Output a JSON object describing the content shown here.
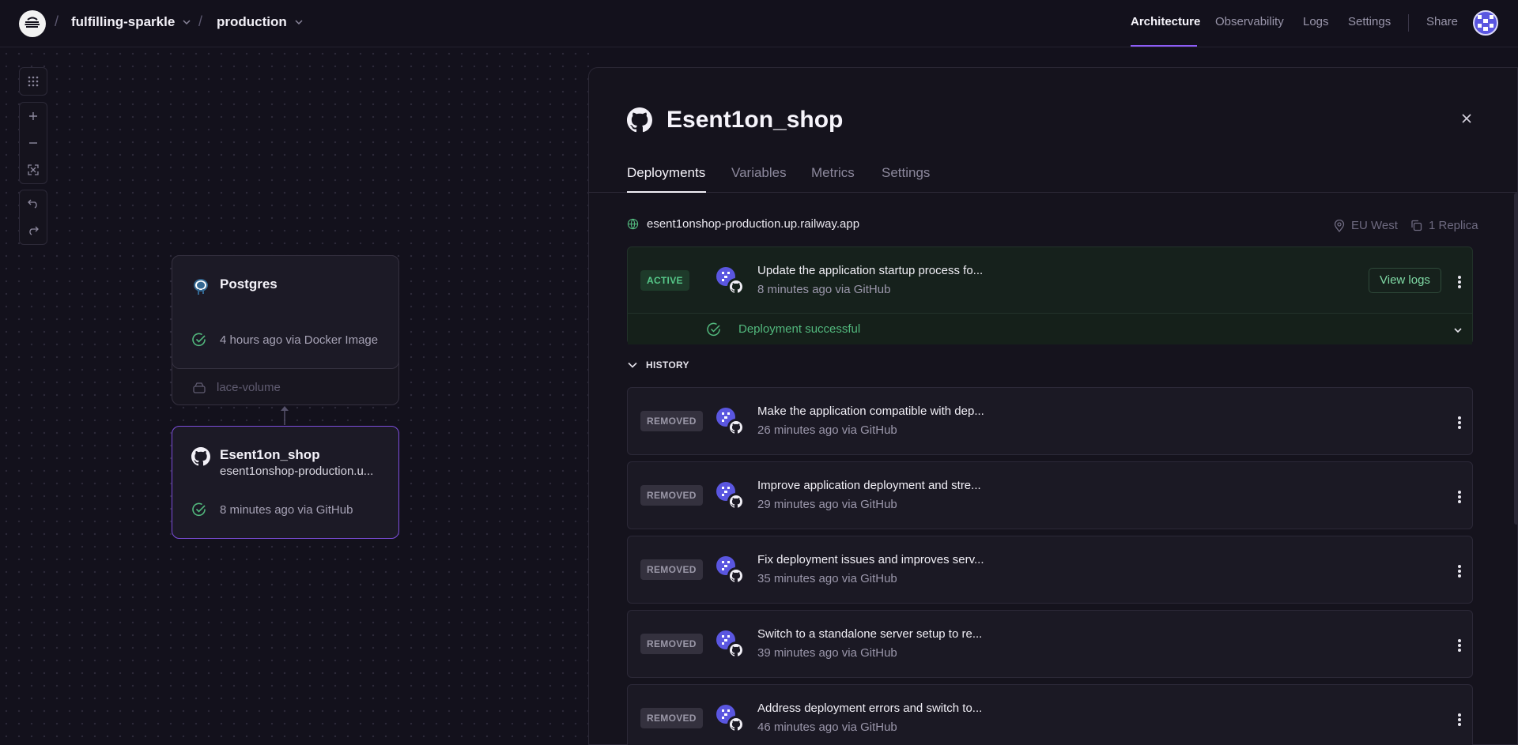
{
  "topbar": {
    "project": "fulfilling-sparkle",
    "environment": "production",
    "nav": [
      "Architecture",
      "Observability",
      "Logs",
      "Settings"
    ],
    "share": "Share"
  },
  "canvas": {
    "tools": [
      "grid-icon",
      "zoom-in-icon",
      "zoom-out-icon",
      "fit-icon",
      "undo-icon",
      "redo-icon"
    ],
    "postgres": {
      "name": "Postgres",
      "status": "4 hours ago via Docker Image",
      "volume": "lace-volume"
    },
    "service": {
      "name": "Esent1on_shop",
      "url": "esent1onshop-production.u...",
      "status": "8 minutes ago via GitHub"
    }
  },
  "panel": {
    "title": "Esent1on_shop",
    "tabs": [
      "Deployments",
      "Variables",
      "Metrics",
      "Settings"
    ],
    "url": "esent1onshop-production.up.railway.app",
    "region": "EU West",
    "replicas": "1 Replica",
    "active": {
      "badge": "ACTIVE",
      "title": "Update the application startup process fo...",
      "meta": "8 minutes ago via GitHub",
      "view_logs": "View logs",
      "status": "Deployment successful"
    },
    "history_label": "HISTORY",
    "history": [
      {
        "badge": "REMOVED",
        "title": "Make the application compatible with dep...",
        "meta": "26 minutes ago via GitHub"
      },
      {
        "badge": "REMOVED",
        "title": "Improve application deployment and stre...",
        "meta": "29 minutes ago via GitHub"
      },
      {
        "badge": "REMOVED",
        "title": "Fix deployment issues and improves serv...",
        "meta": "35 minutes ago via GitHub"
      },
      {
        "badge": "REMOVED",
        "title": "Switch to a standalone server setup to re...",
        "meta": "39 minutes ago via GitHub"
      },
      {
        "badge": "REMOVED",
        "title": "Address deployment errors and switch to...",
        "meta": "46 minutes ago via GitHub"
      }
    ]
  },
  "colors": {
    "accent": "#8c5cf6",
    "success": "#52b87d",
    "background": "#13111c"
  }
}
